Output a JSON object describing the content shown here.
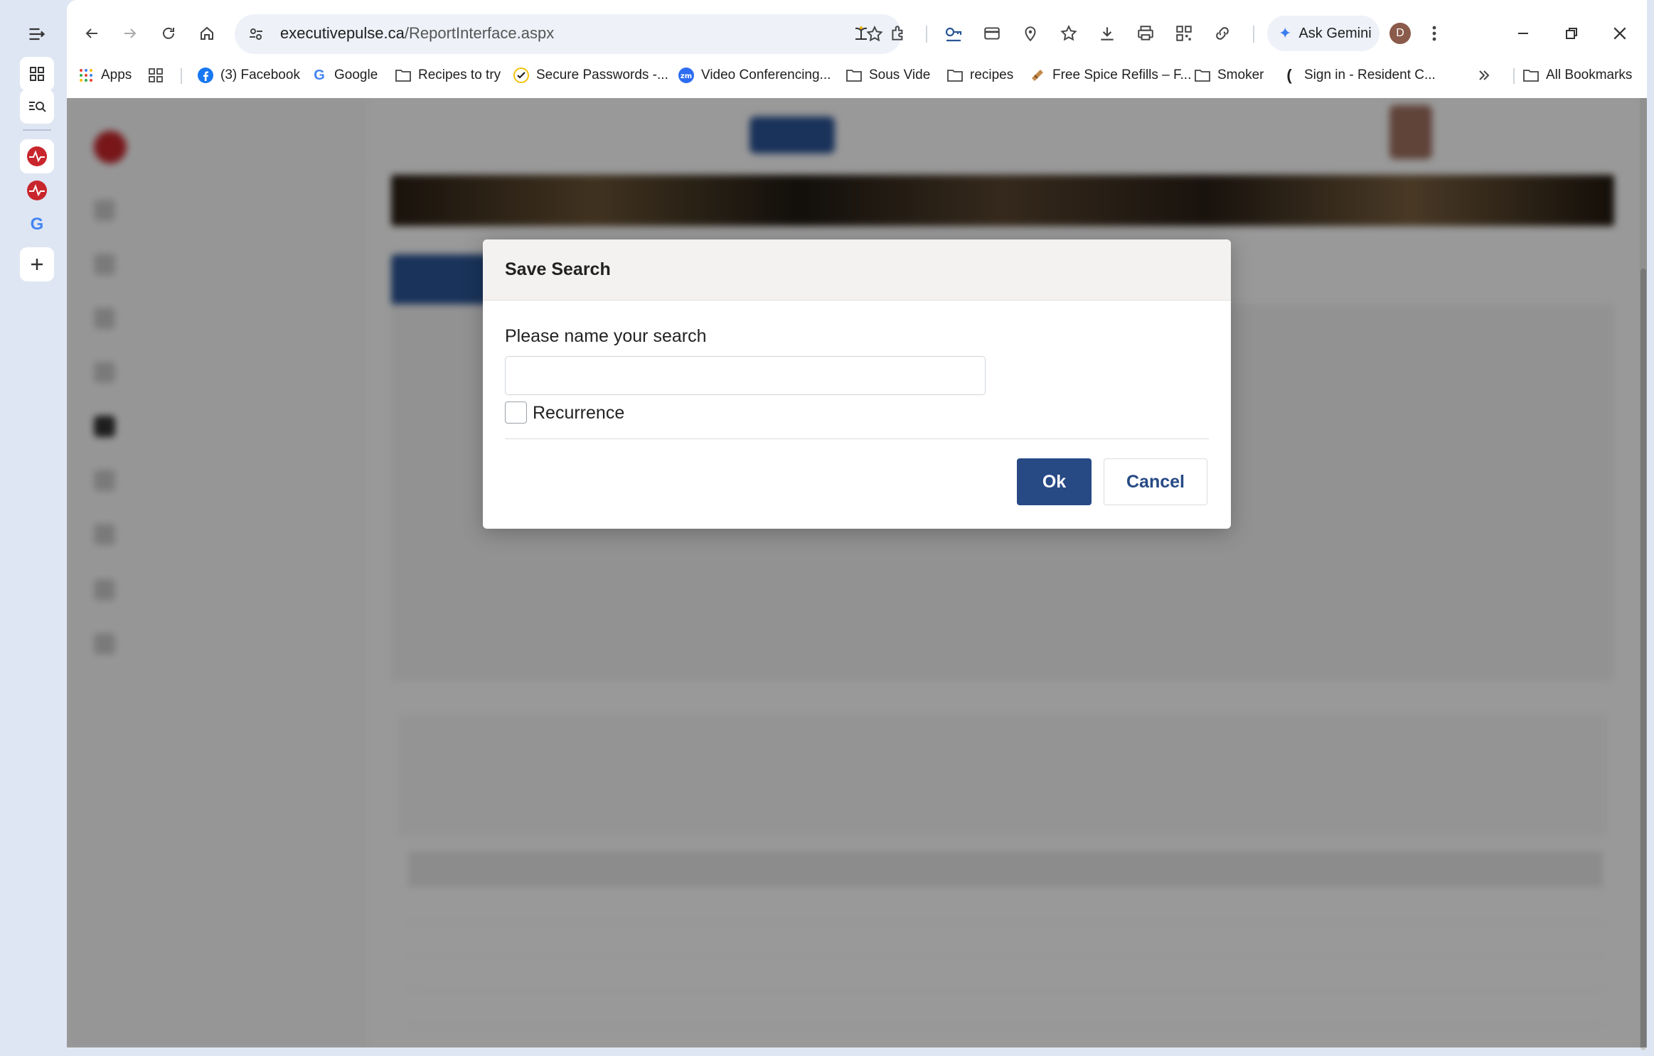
{
  "browser": {
    "url_domain": "executivepulse.ca",
    "url_path": "/ReportInterface.aspx",
    "gemini_label": "Ask Gemini",
    "profile_initial": "D",
    "bookmarks": [
      {
        "label": "Apps",
        "icon": "apps-grid-icon"
      },
      {
        "label": "(3) Facebook",
        "icon": "facebook-icon"
      },
      {
        "label": "Google",
        "icon": "google-icon"
      },
      {
        "label": "Recipes to try",
        "icon": "folder-icon"
      },
      {
        "label": "Secure Passwords -...",
        "icon": "check-circle-icon"
      },
      {
        "label": "Video Conferencing...",
        "icon": "zoom-icon"
      },
      {
        "label": "Sous Vide",
        "icon": "folder-icon"
      },
      {
        "label": "recipes",
        "icon": "folder-icon"
      },
      {
        "label": "Free Spice Refills – F...",
        "icon": "spice-icon"
      },
      {
        "label": "Smoker",
        "icon": "folder-icon"
      },
      {
        "label": "Sign in - Resident C...",
        "icon": "resident-icon"
      }
    ],
    "all_bookmarks_label": "All Bookmarks",
    "colors": {
      "accent": "#274a85",
      "gemini_spark": "#3a7cf0"
    }
  },
  "modal": {
    "title": "Save Search",
    "name_label": "Please name your search",
    "name_value": "",
    "recurrence_label": "Recurrence",
    "recurrence_checked": false,
    "ok_label": "Ok",
    "cancel_label": "Cancel"
  }
}
